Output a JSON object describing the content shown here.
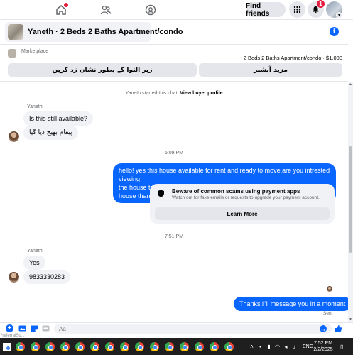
{
  "topnav": {
    "home_icon": "home-icon",
    "groups_icon": "groups-icon",
    "profile_icon": "profile-icon",
    "find_friends": "Find friends",
    "menu_icon": "grid-menu-icon",
    "bell_icon": "bell-icon",
    "notification_count": "1"
  },
  "chat": {
    "title": "Yaneth · 2 Beds 2 Baths Apartment/condo",
    "info_icon": "i"
  },
  "marketplace": {
    "label": "Marketplace",
    "listing": "2 Beds 2 Baths Apartment/condo · $1,000",
    "action_left": "زیر التوا کے بطور نشان زد کریں",
    "action_right": "مزید آپشنز"
  },
  "messages": {
    "started": "Yaneth started this chat.",
    "view_profile": "View buyer profile",
    "sender_1": "Yaneth",
    "msg_1": "Is this still available?",
    "msg_2": "پیغام بھیج دیا گیا",
    "time_1": "6:09 PM",
    "out_1_line1": "hello! yes this house available for rent and ready to move.are you intrested viewing",
    "out_1_line2": "the house tour.kindly send your number i will share all detail about this house thanks.",
    "warn_title": "Beware of common scams using payment apps",
    "warn_sub": "Watch out for fake emails or requests to upgrade your payment account.",
    "learn_more": "Learn More",
    "time_2": "7:51 PM",
    "sender_2": "Yaneth",
    "msg_3": "Yes",
    "msg_4": "9833330283",
    "out_2": "Thanks i\"ll message you in a moment",
    "sent": "Sent"
  },
  "composer": {
    "placeholder": "Aa",
    "referral": "?referralSu..."
  },
  "taskbar": {
    "lang": "ENG",
    "time": "7:52 PM",
    "date": "2/2/2025"
  },
  "colors": {
    "accent": "#0866ff",
    "bubble_in": "#f0f2f5",
    "badge": "#e41e3f"
  }
}
